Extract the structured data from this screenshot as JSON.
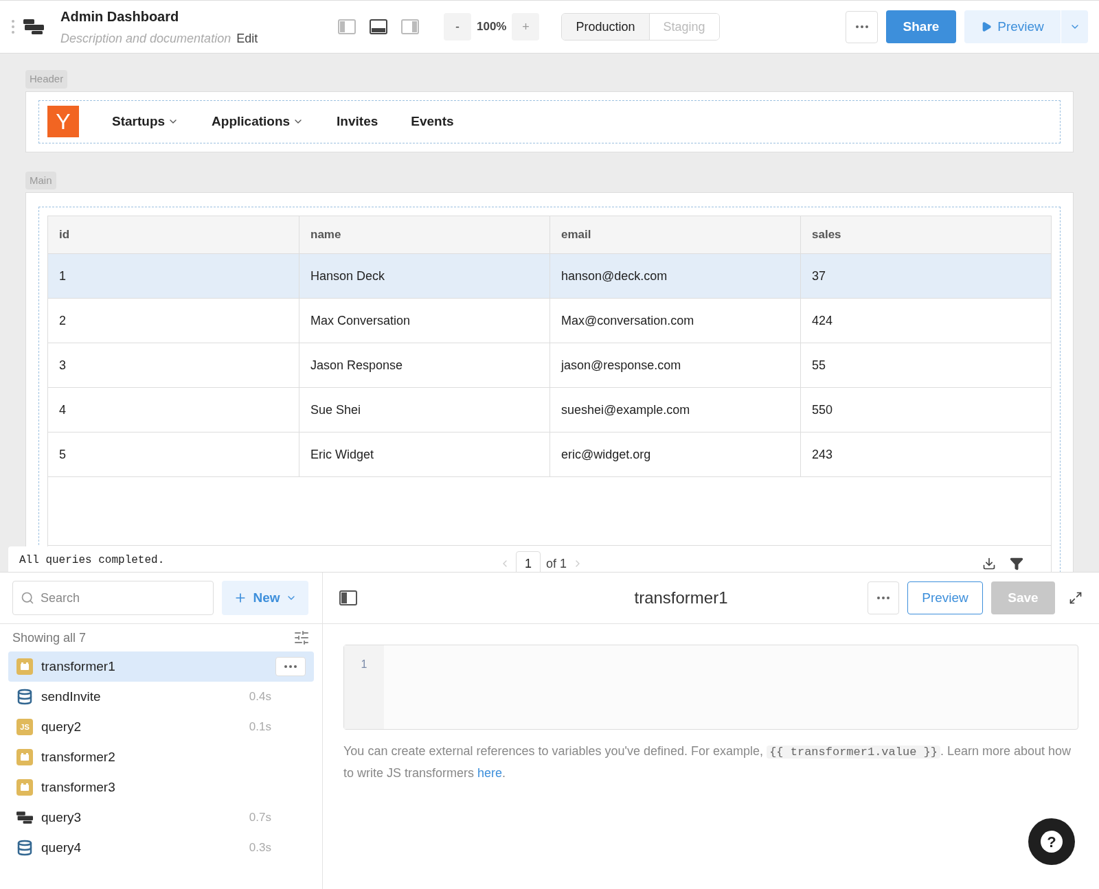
{
  "toolbar": {
    "title": "Admin Dashboard",
    "description_placeholder": "Description and documentation",
    "edit_label": "Edit",
    "layout_buttons": [
      {
        "kind": "left",
        "selected": false
      },
      {
        "kind": "bottom",
        "selected": true
      },
      {
        "kind": "right",
        "selected": false
      }
    ],
    "zoom": {
      "minus": "-",
      "value": "100%",
      "plus": "+"
    },
    "environments": [
      {
        "label": "Production",
        "selected": true
      },
      {
        "label": "Staging",
        "selected": false
      }
    ],
    "share_label": "Share",
    "preview_label": "Preview"
  },
  "canvas": {
    "header_section": {
      "label": "Header",
      "logo": "Y",
      "nav_items": [
        {
          "label": "Startups",
          "dropdown": true
        },
        {
          "label": "Applications",
          "dropdown": true
        },
        {
          "label": "Invites",
          "dropdown": false
        },
        {
          "label": "Events",
          "dropdown": false
        }
      ]
    },
    "main_section": {
      "label": "Main",
      "table": {
        "columns": [
          "id",
          "name",
          "email",
          "sales"
        ],
        "rows": [
          {
            "cells": [
              "1",
              "Hanson Deck",
              "hanson@deck.com",
              "37"
            ],
            "selected": true
          },
          {
            "cells": [
              "2",
              "Max Conversation",
              "Max@conversation.com",
              "424"
            ],
            "selected": false
          },
          {
            "cells": [
              "3",
              "Jason Response",
              "jason@response.com",
              "55"
            ],
            "selected": false
          },
          {
            "cells": [
              "4",
              "Sue Shei",
              "sueshei@example.com",
              "550"
            ],
            "selected": false
          },
          {
            "cells": [
              "5",
              "Eric Widget",
              "eric@widget.org",
              "243"
            ],
            "selected": false
          }
        ],
        "pagination": {
          "page": "1",
          "of": "of 1"
        }
      }
    },
    "toast": "All queries completed."
  },
  "query_panel": {
    "search": {
      "placeholder": "Search"
    },
    "new_label": "New",
    "count": "Showing all 7",
    "queries": [
      {
        "kind": "transformer",
        "name": "transformer1",
        "selected": true
      },
      {
        "kind": "postgres",
        "name": "sendInvite",
        "time": "0.4s",
        "selected": false
      },
      {
        "kind": "js",
        "icon_text": "JS",
        "name": "query2",
        "time": "0.1s",
        "selected": false
      },
      {
        "kind": "transformer",
        "name": "transformer2",
        "selected": false
      },
      {
        "kind": "transformer",
        "name": "transformer3",
        "selected": false
      },
      {
        "kind": "rest",
        "name": "query3",
        "time": "0.7s",
        "selected": false
      },
      {
        "kind": "postgres",
        "name": "query4",
        "time": "0.3s",
        "selected": false
      }
    ]
  },
  "editor": {
    "title": "transformer1",
    "preview_label": "Preview",
    "save_label": "Save",
    "save_disabled": true,
    "line_numbers": [
      "1"
    ],
    "help": {
      "before": "You can create external references to variables you've defined. For example, ",
      "code": "{{ transformer1.value }}",
      "middle": ". Learn more about how to write JS transformers ",
      "link": "here",
      "after": "."
    }
  },
  "help_bubble": "?"
}
